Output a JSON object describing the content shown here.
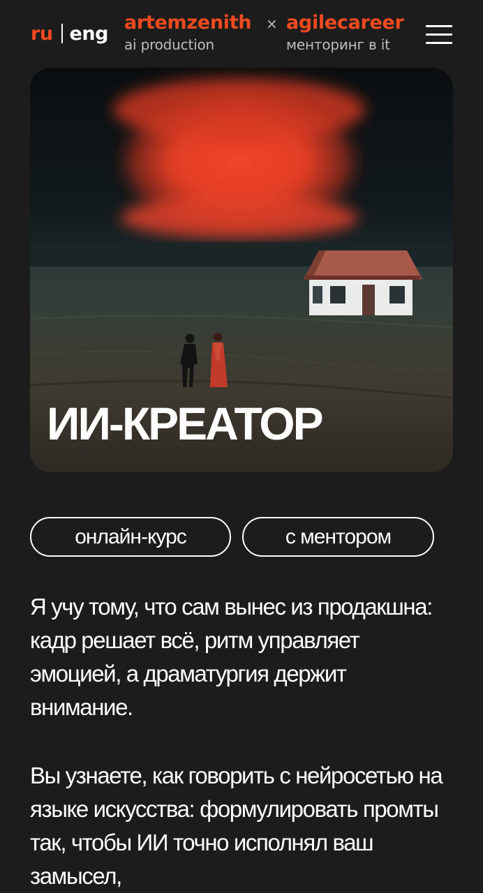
{
  "header": {
    "lang_ru": "ru",
    "lang_eng": "eng",
    "brand_one": {
      "name": "artemzenith",
      "subtitle": "ai production"
    },
    "times": "×",
    "brand_two": {
      "name": "agilecareer",
      "subtitle": "менторинг в it"
    },
    "menu_icon": "hamburger-menu-icon"
  },
  "hero": {
    "title": "ИИ-КРЕАТОР"
  },
  "tags": [
    {
      "label": "онлайн-курс"
    },
    {
      "label": "с ментором"
    }
  ],
  "paragraphs": [
    "Я учу тому, что сам вынес из продакшна: кадр решает всё, ритм управляет эмоцией, а драматургия держит внимание.",
    "Вы узнаете, как говорить с нейросетью на языке искусства: формулировать промты так, чтобы ИИ точно исполнял ваш замысел,"
  ],
  "colors": {
    "background": "#1c1c1c",
    "accent": "#f04a1f",
    "text": "#ffffff",
    "muted": "#bdbdbd"
  }
}
